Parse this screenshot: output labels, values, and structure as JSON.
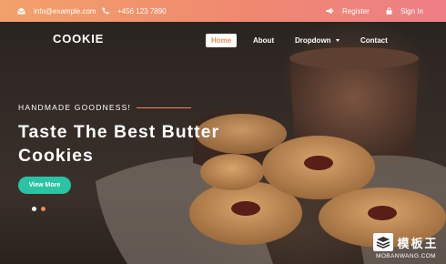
{
  "topbar": {
    "email": "info@example.com",
    "phone": "+456 123 7890",
    "register": "Register",
    "signin": "Sign In"
  },
  "nav": {
    "logo": "COOKIE",
    "items": [
      "Home",
      "About",
      "Dropdown",
      "Contact"
    ],
    "active": "Home"
  },
  "hero": {
    "tagline": "HANDMADE  GOODNESS!",
    "headline_line1": "Taste The Best Butter",
    "headline_line2": "Cookies",
    "cta": "View More",
    "slides": 2,
    "active_slide": 1
  },
  "colors": {
    "topbar_start": "#f2a16a",
    "topbar_end": "#ee7f86",
    "accent": "#ef8a5b",
    "cta": "#2bc3a6"
  },
  "watermark": {
    "cn": "模板王",
    "en": "MOBANWANG.COM"
  }
}
